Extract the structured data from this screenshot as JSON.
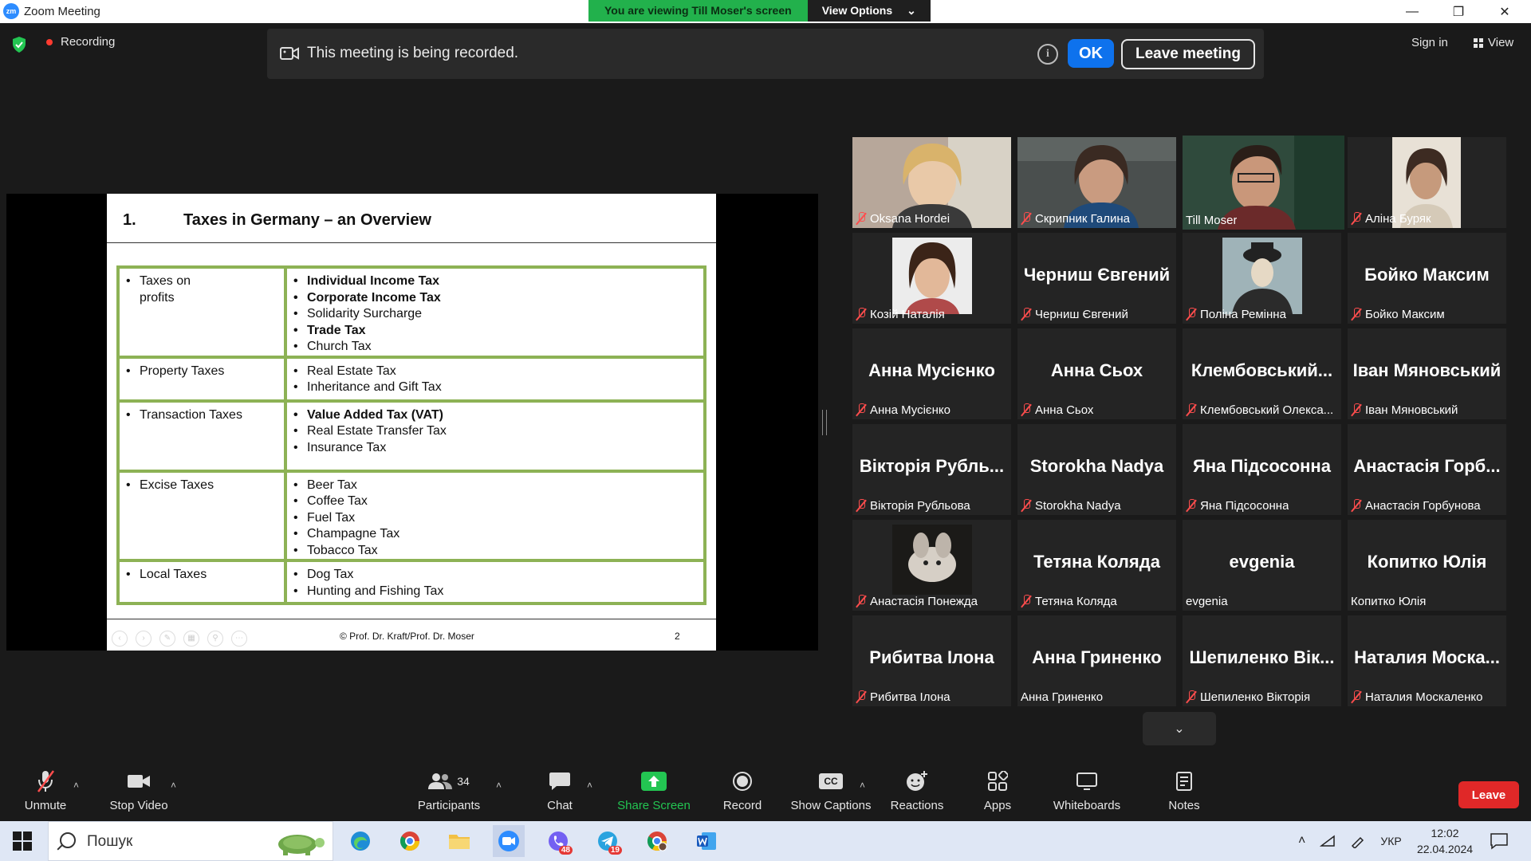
{
  "window": {
    "app_logo": "zm",
    "title": "Zoom Meeting"
  },
  "share_banner": {
    "viewing_text": "You are viewing Till Moser's screen",
    "view_options": "View Options"
  },
  "status": {
    "recording": "Recording"
  },
  "recording_notice": {
    "text": "This meeting is being recorded.",
    "ok": "OK",
    "leave_meeting": "Leave meeting"
  },
  "top_right": {
    "sign_in": "Sign in",
    "view": "View"
  },
  "slide": {
    "number": "1.",
    "title": "Taxes in Germany – an Overview",
    "rows": [
      {
        "category_line1": "Taxes on",
        "category_line2": "profits",
        "items": [
          {
            "t": "Individual Income Tax",
            "bold": true
          },
          {
            "t": "Corporate Income Tax",
            "bold": true
          },
          {
            "t": "Solidarity Surcharge",
            "bold": false
          },
          {
            "t": "Trade Tax",
            "bold": true
          },
          {
            "t": "Church Tax",
            "bold": false
          }
        ]
      },
      {
        "category_line1": "Property Taxes",
        "items": [
          {
            "t": "Real Estate Tax",
            "bold": false
          },
          {
            "t": "Inheritance and Gift Tax",
            "bold": false
          }
        ]
      },
      {
        "category_line1": "Transaction Taxes",
        "items": [
          {
            "t": "Value Added Tax (VAT)",
            "bold": true
          },
          {
            "t": "Real Estate Transfer Tax",
            "bold": false
          },
          {
            "t": "Insurance Tax",
            "bold": false
          }
        ]
      },
      {
        "category_line1": "Excise Taxes",
        "items": [
          {
            "t": "Beer Tax",
            "bold": false
          },
          {
            "t": "Coffee Tax",
            "bold": false
          },
          {
            "t": "Fuel Tax",
            "bold": false
          },
          {
            "t": "Champagne Tax",
            "bold": false
          },
          {
            "t": "Tobacco Tax",
            "bold": false
          }
        ]
      },
      {
        "category_line1": "Local Taxes",
        "items": [
          {
            "t": "Dog Tax",
            "bold": false
          },
          {
            "t": "Hunting and Fishing Tax",
            "bold": false
          }
        ]
      }
    ],
    "footer": "© Prof. Dr. Kraft/Prof. Dr. Moser",
    "page": "2"
  },
  "participants_tiles": [
    {
      "name": "Oksana Hordei",
      "big": "",
      "muted": true,
      "video": true
    },
    {
      "name": "Скрипник Галина",
      "big": "",
      "muted": true,
      "video": true
    },
    {
      "name": "Till Moser",
      "big": "",
      "muted": false,
      "video": true,
      "active": true
    },
    {
      "name": "Аліна Буряк",
      "big": "",
      "muted": true,
      "video": true
    },
    {
      "name": "Козій Наталія",
      "big": "",
      "muted": true,
      "video": true
    },
    {
      "name": "Черниш Євгений",
      "big": "Черниш Євгений",
      "muted": true
    },
    {
      "name": "Поліна Ремінна",
      "big": "",
      "muted": true,
      "video": true
    },
    {
      "name": "Бойко Максим",
      "big": "Бойко Максим",
      "muted": true
    },
    {
      "name": "Анна Мусієнко",
      "big": "Анна Мусієнко",
      "muted": true
    },
    {
      "name": "Анна Сьох",
      "big": "Анна Сьох",
      "muted": true
    },
    {
      "name": "Клембовський Олекса...",
      "big": "Клембовський...",
      "muted": true
    },
    {
      "name": "Іван Мяновський",
      "big": "Іван Мяновський",
      "muted": true
    },
    {
      "name": "Вікторія Рубльова",
      "big": "Вікторія Рубль...",
      "muted": true
    },
    {
      "name": "Storokha Nadya",
      "big": "Storokha Nadya",
      "muted": true
    },
    {
      "name": "Яна Підсосонна",
      "big": "Яна Підсосонна",
      "muted": true
    },
    {
      "name": "Анастасія Горбунова",
      "big": "Анастасія Горб...",
      "muted": true
    },
    {
      "name": "Анастасія Понежда",
      "big": "",
      "muted": true,
      "video": true
    },
    {
      "name": "Тетяна Коляда",
      "big": "Тетяна Коляда",
      "muted": true
    },
    {
      "name": "evgenia",
      "big": "evgenia",
      "muted": false
    },
    {
      "name": "Копитко Юлія",
      "big": "Копитко Юлія",
      "muted": false
    },
    {
      "name": "Рибитва Ілона",
      "big": "Рибитва Ілона",
      "muted": true
    },
    {
      "name": "Анна Гриненко",
      "big": "Анна Гриненко",
      "muted": false
    },
    {
      "name": "Шепиленко Вікторія",
      "big": "Шепиленко Вік...",
      "muted": true
    },
    {
      "name": "Наталия Москаленко",
      "big": "Наталия Моска...",
      "muted": true
    }
  ],
  "toolbar": {
    "unmute": "Unmute",
    "stop_video": "Stop Video",
    "participants": "Participants",
    "participants_count": "34",
    "chat": "Chat",
    "share_screen": "Share Screen",
    "record": "Record",
    "show_captions": "Show Captions",
    "captions_icon": "CC",
    "reactions": "Reactions",
    "apps": "Apps",
    "whiteboards": "Whiteboards",
    "notes": "Notes",
    "leave": "Leave"
  },
  "taskbar": {
    "search_placeholder": "Пошук",
    "viber_badge": "48",
    "telegram_badge": "19",
    "lang": "УКР",
    "time": "12:02",
    "date": "22.04.2024"
  },
  "colors": {
    "accent": "#0e72ed",
    "share_green": "#22b14c",
    "active_speaker": "#d4e157",
    "leave_red": "#e02828",
    "table_green": "#8db255"
  }
}
